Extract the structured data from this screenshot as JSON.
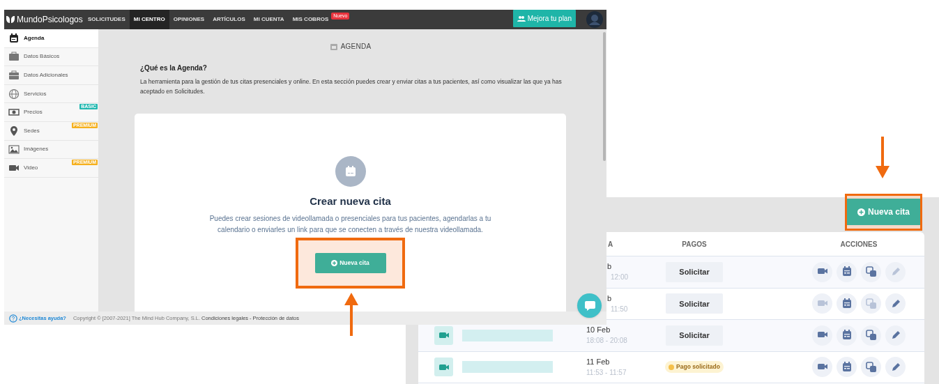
{
  "main_screen": {
    "nav": {
      "logo": "MundoPsicologos",
      "items": [
        {
          "label": "SOLICITUDES",
          "selected": false
        },
        {
          "label": "MI CENTRO",
          "selected": true
        },
        {
          "label": "OPINIONES",
          "selected": false
        },
        {
          "label": "ARTÍCULOS",
          "selected": false
        },
        {
          "label": "MI CUENTA",
          "selected": false
        },
        {
          "label": "MIS COBROS",
          "selected": false,
          "badge": "Nuevo"
        }
      ],
      "upgrade_button": "Mejora tu plan"
    },
    "sidebar": {
      "items": [
        {
          "label": "Agenda",
          "selected": true
        },
        {
          "label": "Datos Básicos",
          "selected": false
        },
        {
          "label": "Datos Adicionales",
          "selected": false
        },
        {
          "label": "Servicios",
          "selected": false
        },
        {
          "label": "Precios",
          "selected": false,
          "badge": {
            "text": "BASIC",
            "color": "#22b8b0"
          }
        },
        {
          "label": "Sedes",
          "selected": false,
          "badge": {
            "text": "PREMIUM",
            "color": "#f5b01e"
          }
        },
        {
          "label": "Imágenes",
          "selected": false
        },
        {
          "label": "Video",
          "selected": false,
          "badge": {
            "text": "PREMIUM",
            "color": "#f5b01e"
          }
        }
      ]
    },
    "page_title": "AGENDA",
    "intro": {
      "heading": "¿Qué es la Agenda?",
      "text": "La herramienta para la gestión de tus citas presenciales y online. En esta sección puedes crear y enviar citas a tus pacientes, así como visualizar las que ya has aceptado en Solicitudes."
    },
    "card": {
      "title": "Crear nueva cita",
      "text": "Puedes crear sesiones de videollamada o presenciales para tus pacientes, agendarlas a tu calendario o enviarles un link para que se conecten a través de nuestra videollamada.",
      "button": "Nueva cita",
      "highlighted": true
    },
    "footer": {
      "help_link": "¿Necesitas ayuda?",
      "copyright": "Copyright © [2007-2021] The Mind Hub Company, S.L.",
      "links": [
        "Condiciones legales",
        "Protección de datos"
      ],
      "separator": "-"
    }
  },
  "table_screen": {
    "button": "Nueva cita",
    "highlighted": true,
    "columns": [
      "A",
      "PAGOS",
      "ACCIONES"
    ],
    "rows": [
      {
        "partial": true,
        "date": "b",
        "time": "12:00",
        "payment": {
          "kind": "button",
          "label": "Solicitar"
        },
        "actions": [
          {
            "kind": "video",
            "disabled": false
          },
          {
            "kind": "calendar",
            "disabled": false
          },
          {
            "kind": "copy",
            "disabled": false
          },
          {
            "kind": "edit",
            "disabled": true
          }
        ]
      },
      {
        "partial": true,
        "date": "b",
        "time": "11:50",
        "payment": {
          "kind": "button",
          "label": "Solicitar"
        },
        "actions": [
          {
            "kind": "video",
            "disabled": true
          },
          {
            "kind": "calendar",
            "disabled": false
          },
          {
            "kind": "copy",
            "disabled": true
          },
          {
            "kind": "edit",
            "disabled": false
          }
        ]
      },
      {
        "partial": false,
        "date": "10 Feb",
        "time": "18:08 - 20:08",
        "payment": {
          "kind": "button",
          "label": "Solicitar"
        },
        "actions": [
          {
            "kind": "video",
            "disabled": false
          },
          {
            "kind": "calendar",
            "disabled": false
          },
          {
            "kind": "copy",
            "disabled": false
          },
          {
            "kind": "edit",
            "disabled": false
          }
        ]
      },
      {
        "partial": false,
        "date": "11 Feb",
        "time": "11:53 - 11:57",
        "payment": {
          "kind": "status",
          "label": "Pago solicitado"
        },
        "actions": [
          {
            "kind": "video",
            "disabled": false
          },
          {
            "kind": "calendar",
            "disabled": false
          },
          {
            "kind": "copy",
            "disabled": false
          },
          {
            "kind": "edit",
            "disabled": false
          }
        ]
      }
    ]
  }
}
